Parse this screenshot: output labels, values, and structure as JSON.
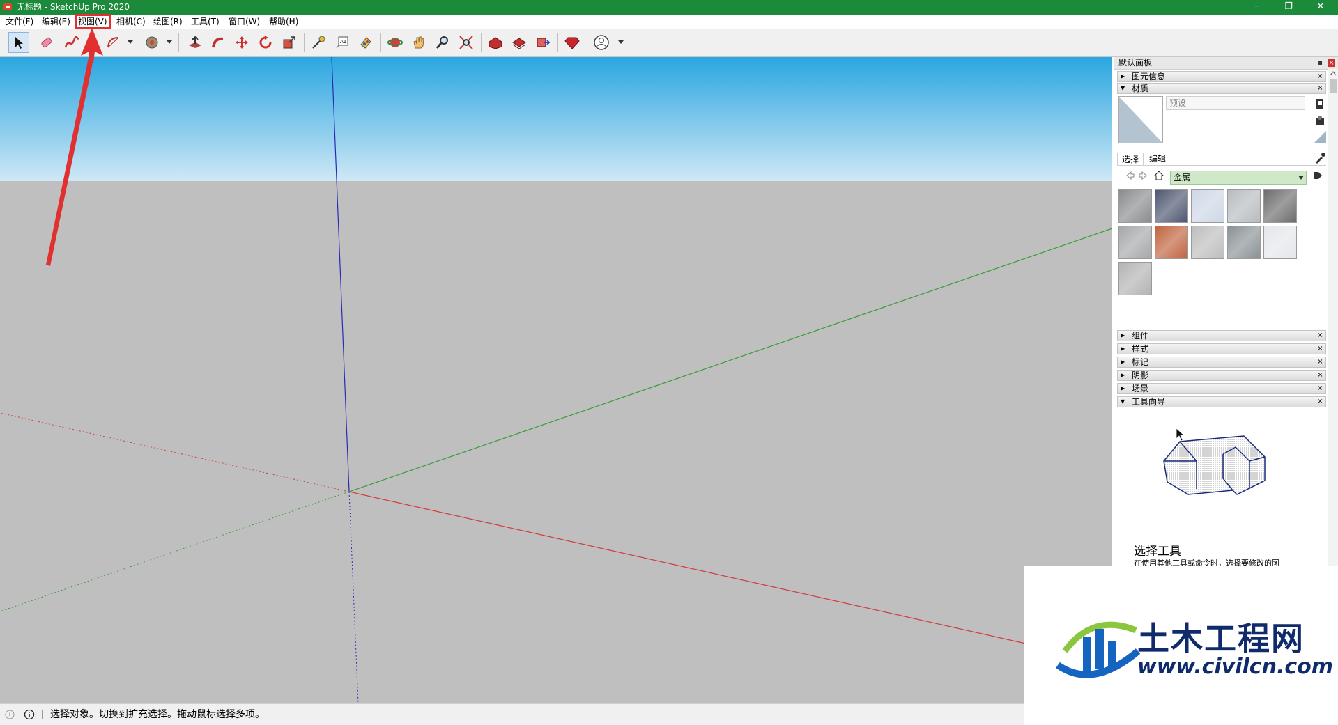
{
  "window": {
    "title": "无标题 - SketchUp Pro 2020",
    "controls": {
      "minimize": "─",
      "maximize": "❐",
      "close": "✕"
    }
  },
  "menubar": {
    "items": [
      "文件(F)",
      "编辑(E)",
      "视图(V)",
      "相机(C)",
      "绘图(R)",
      "工具(T)",
      "窗口(W)",
      "帮助(H)"
    ],
    "highlighted": "视图(V)"
  },
  "toolbar": {
    "tools": [
      "select-icon",
      "eraser-icon",
      "freehand-icon",
      "arc-icon",
      "paint-bucket-icon",
      "push-pull-icon",
      "follow-me-icon",
      "move-icon",
      "rotate-icon",
      "scale-icon",
      "tape-measure-icon",
      "text-icon",
      "paint-icon",
      "orbit-icon",
      "pan-icon",
      "zoom-icon",
      "zoom-extents-icon",
      "warehouse-icon",
      "extension-warehouse-icon",
      "send-to-layout-icon",
      "ruby-icon",
      "account-icon"
    ]
  },
  "statusbar": {
    "message": "选择对象。切换到扩充选择。拖动鼠标选择多项。"
  },
  "tray": {
    "title": "默认面板",
    "panels_top": [
      {
        "label": "图元信息",
        "expanded": false
      },
      {
        "label": "材质",
        "expanded": true
      }
    ],
    "materials": {
      "name_placeholder": "预设",
      "tabs": [
        "选择",
        "编辑"
      ],
      "library": "金属",
      "swatches": [
        {
          "name": "metal-pattern-1",
          "color": "#8a8c8f"
        },
        {
          "name": "metal-pattern-2",
          "color": "#4e5670"
        },
        {
          "name": "metal-pattern-3",
          "color": "#cdd7e6"
        },
        {
          "name": "metal-pattern-4",
          "color": "#b7bcbf"
        },
        {
          "name": "metal-pattern-5",
          "color": "#6d6d6d"
        },
        {
          "name": "metal-pattern-6",
          "color": "#a5a7aa"
        },
        {
          "name": "metal-pattern-7",
          "color": "#c0643f"
        },
        {
          "name": "metal-pattern-8",
          "color": "#bdbdbd"
        },
        {
          "name": "metal-pattern-9",
          "color": "#8a9296"
        },
        {
          "name": "metal-pattern-10",
          "color": "#e4e6ea"
        },
        {
          "name": "metal-pattern-11",
          "color": "#b3b3b3"
        }
      ]
    },
    "panels_bottom": [
      {
        "label": "组件",
        "expanded": false
      },
      {
        "label": "样式",
        "expanded": false
      },
      {
        "label": "标记",
        "expanded": false
      },
      {
        "label": "阴影",
        "expanded": false
      },
      {
        "label": "场景",
        "expanded": false
      },
      {
        "label": "工具向导",
        "expanded": true
      }
    ],
    "guide": {
      "title": "选择工具",
      "description": "在使用其他工具或命令时，选择要修改的图"
    }
  },
  "watermark": {
    "name_cn": "土木工程网",
    "url": "www.civilcn.com"
  },
  "colors": {
    "titlebar": "#1b8a3a",
    "sky_top": "#2aa6e0",
    "sky_bottom": "#cfe8f6",
    "ground": "#bfbfbf",
    "axis_red": "#d23c3c",
    "axis_green": "#3a9c3a",
    "axis_blue": "#2a2ab8",
    "annotation_red": "#e03030"
  }
}
